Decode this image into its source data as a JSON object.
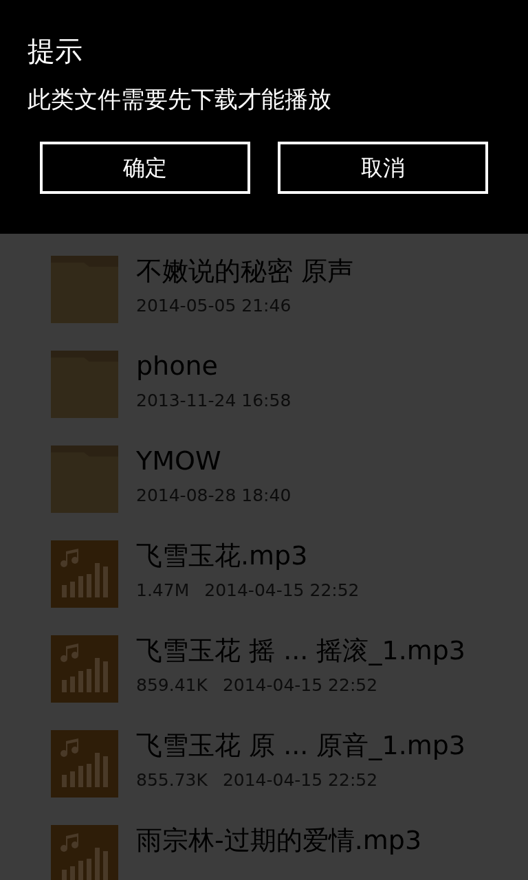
{
  "dialog": {
    "title": "提示",
    "message": "此类文件需要先下载才能播放",
    "buttons": [
      "确定",
      "取消"
    ]
  },
  "files": [
    {
      "kind": "folder",
      "name": "不嫩说的秘密 原声",
      "date": "2014-05-05 21:46"
    },
    {
      "kind": "folder",
      "name": "phone",
      "date": "2013-11-24 16:58"
    },
    {
      "kind": "folder",
      "name": "YMOW",
      "date": "2014-08-28 18:40"
    },
    {
      "kind": "audio",
      "name": "飞雪玉花.mp3",
      "size": "1.47M",
      "date": "2014-04-15 22:52"
    },
    {
      "kind": "audio",
      "name": "飞雪玉花 摇 ... 摇滚_1.mp3",
      "size": "859.41K",
      "date": "2014-04-15 22:52"
    },
    {
      "kind": "audio",
      "name": "飞雪玉花 原 ... 原音_1.mp3",
      "size": "855.73K",
      "date": "2014-04-15 22:52"
    },
    {
      "kind": "audio",
      "name": "雨宗林-过期的爱情.mp3"
    }
  ]
}
